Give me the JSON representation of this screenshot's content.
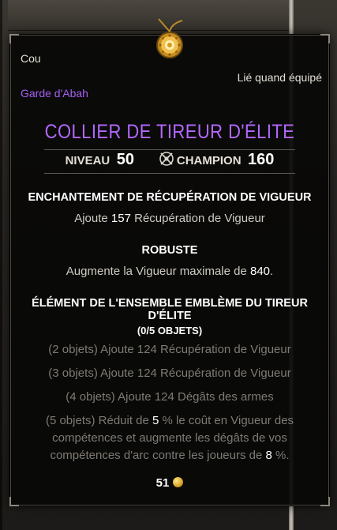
{
  "item": {
    "slot": "Cou",
    "bind_status": "Lié quand équipé",
    "set_origin": "Garde d'Abah",
    "name": "COLLIER DE TIREUR D'ÉLITE",
    "level_label": "NIVEAU",
    "level_value": "50",
    "champion_label": "CHAMPION",
    "champion_value": "160",
    "icon": "golden-amulet-icon"
  },
  "enchantment": {
    "title": "ENCHANTEMENT DE RÉCUPÉRATION DE VIGUEUR",
    "pre": "Ajoute ",
    "value": "157",
    "post": " Récupération de Vigueur"
  },
  "trait": {
    "title": "ROBUSTE",
    "pre": "Augmente la Vigueur maximale de ",
    "value": "840",
    "post": "."
  },
  "set": {
    "title": "ÉLÉMENT DE L'ENSEMBLE EMBLÈME DU TIREUR D'ÉLITE",
    "count": "(0/5 OBJETS)",
    "bonus2": "(2 objets) Ajoute 124 Récupération de Vigueur",
    "bonus3": "(3 objets) Ajoute 124 Récupération de Vigueur",
    "bonus4": "(4 objets) Ajoute 124 Dégâts des armes",
    "bonus5_a": "(5 objets) Réduit de ",
    "bonus5_v1": "5",
    "bonus5_b": " % le coût en Vigueur des compétences et augmente les dégâts de vos compétences d'arc contre les joueurs de ",
    "bonus5_v2": "8",
    "bonus5_c": " %."
  },
  "value": {
    "gold": "51",
    "icon": "gold-coin-icon"
  },
  "colors": {
    "item_name": "#b468ff",
    "set_origin": "#a560f0",
    "inactive_set": "#7f7b73",
    "text": "#e4e0d6"
  }
}
